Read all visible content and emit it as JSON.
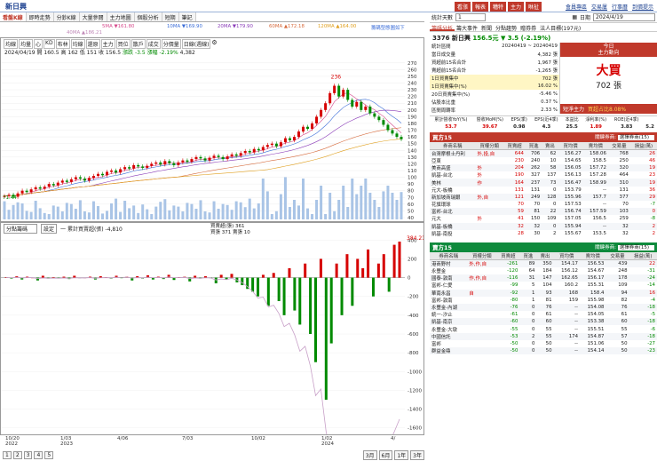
{
  "window": {
    "title": "新日興"
  },
  "top_buttons": [
    "看漲",
    "報表",
    "糟特",
    "主力",
    "咻扯"
  ],
  "top_links": [
    "會員專區",
    "交易屢",
    "行事曆",
    "到價提示"
  ],
  "tabs": [
    {
      "label": "看盤K線",
      "active": true
    },
    {
      "label": "即時走勢"
    },
    {
      "label": "分鈔K線"
    },
    {
      "label": "大量參閱"
    },
    {
      "label": "主力地圖"
    },
    {
      "label": "個股分析"
    },
    {
      "label": "短期"
    },
    {
      "label": "筆記"
    }
  ],
  "ma_legend": [
    {
      "label": "5MA ▼161.80",
      "color": "#d64b8c"
    },
    {
      "label": "10MA ▼169.90",
      "color": "#3c6ed8"
    },
    {
      "label": "20MA ▼179.90",
      "color": "#8a3cb8"
    },
    {
      "label": "60MA ▲172.18",
      "color": "#d66a3c"
    },
    {
      "label": "120MA ▲164.00",
      "color": "#e0a020"
    },
    {
      "label": "40MA ▲186.21",
      "color": "#c08ab8"
    }
  ],
  "ma_note": "籌碼型態圖如下",
  "chart_toolbar": [
    "均線",
    "均量",
    "心",
    "KD",
    "布林",
    "均線",
    "還原",
    "主力",
    "買位",
    "散戶",
    "成交",
    "分價量",
    "日線(週線)"
  ],
  "chart_info": {
    "date_line": "2024/04/19 開 160.5 高 162 低 151 收 156.5",
    "change": "漲跌 -3.5 漲幅 -2.19%",
    "volume": "4,382"
  },
  "price_axis": [
    "270",
    "260",
    "250",
    "240",
    "230",
    "220",
    "210",
    "200",
    "190",
    "180",
    "170",
    "160",
    "150",
    "140",
    "130",
    "120",
    "110",
    "100",
    "90",
    "80",
    "70",
    "60",
    "50",
    "40"
  ],
  "peak_label": "236",
  "low_label": "71.44",
  "sub_chart": {
    "selector": "分點籌碼",
    "btn": "設定",
    "legend_line1": "一 累計買賣超(張) -4,810",
    "legend_line2": "買賣超(張) 361",
    "legend_line3": "買張 371 賣張 10",
    "right_value": "384.21",
    "right_value2": "361",
    "axis": [
      "400",
      "200",
      "0",
      "-200",
      "-400",
      "-600",
      "-800",
      "-1000",
      "-1200",
      "-1400",
      "-1600"
    ]
  },
  "x_axis": [
    {
      "label": "10/20",
      "sub": "2022"
    },
    {
      "label": "1/03",
      "sub": "2023"
    },
    {
      "label": "4/06",
      "sub": ""
    },
    {
      "label": "7/03",
      "sub": ""
    },
    {
      "label": "10/02",
      "sub": ""
    },
    {
      "label": "1/02",
      "sub": "2024"
    },
    {
      "label": "4/",
      "sub": ""
    }
  ],
  "pager": [
    "1",
    "2",
    "3",
    "4",
    "5"
  ],
  "range_btns": [
    "3月",
    "6月",
    "1年",
    "3年"
  ],
  "right_panel": {
    "select_label": "統計天數",
    "days": "1",
    "date_label": "日期",
    "date": "2024/4/19",
    "subtabs": [
      "籌碼分析",
      "籌大事件",
      "新聞",
      "分點趨勢",
      "贈券券",
      "法人目標(197元)"
    ],
    "stock": "3376 新日興",
    "price": "156.5元",
    "change": "▼ 3.5 (-2.19%)",
    "stats": [
      {
        "k": "統計區間",
        "v": "20240419 ~ 20240419"
      },
      {
        "k": "當日成交量",
        "v": "4,382 張"
      },
      {
        "k": "買超前15名合計",
        "v": "1,967 張"
      },
      {
        "k": "賣超前15名合計",
        "v": "-1,265 張"
      },
      {
        "k": "1日買賣集中",
        "v": "702 張"
      },
      {
        "k": "1日買賣集中(%)",
        "v": "16.02 %"
      },
      {
        "k": "20日買賣集中(%)",
        "v": "-5.46 %"
      },
      {
        "k": "佔股本比重",
        "v": "0.37 %"
      },
      {
        "k": "區間周轉率",
        "v": "2.33 %"
      }
    ],
    "today_box": {
      "line1": "今日",
      "line2": "主力動向",
      "big": "大買",
      "amount": "702 張"
    },
    "short_term": {
      "label": "短淨主力",
      "text": "買超占比8.08%"
    },
    "metrics_head": [
      "累計營收YoY(%)",
      "營收MoM(%)",
      "EPS(季)",
      "EPS(近4季)",
      "本益比",
      "淨利率(%)",
      "ROE(近4季)"
    ],
    "metrics_val": [
      "53.7",
      "39.67",
      "0.98",
      "4.3",
      "25.5",
      "1.89",
      "3.83",
      "5.2"
    ],
    "buy_section": {
      "title": "買方15",
      "label": "關鍵券商:",
      "sel": "選擇券商(15)"
    },
    "sell_section": {
      "title": "賣方15",
      "label": "關鍵券商:",
      "sel": "選擇券商(15)"
    },
    "cols": [
      "券商名稱",
      "買權分類",
      "買賣超",
      "買進",
      "賣出",
      "買均價",
      "賣均價",
      "交易量",
      "損益(萬)"
    ],
    "buy_rows": [
      [
        "台灣摩根士丹利",
        "外,投,自",
        "644",
        "706",
        "62",
        "156.27",
        "158.06",
        "768",
        "26"
      ],
      [
        "亞東",
        "",
        "230",
        "240",
        "10",
        "154.65",
        "158.5",
        "250",
        "46"
      ],
      [
        "美商高盛",
        "外",
        "204",
        "262",
        "58",
        "156.05",
        "157.72",
        "320",
        "19"
      ],
      [
        "凱基-台北",
        "外",
        "190",
        "327",
        "137",
        "156.13",
        "157.28",
        "464",
        "23"
      ],
      [
        "美林",
        "作",
        "164",
        "237",
        "73",
        "156.47",
        "158.99",
        "310",
        "19"
      ],
      [
        "元大-板橋",
        "",
        "131",
        "131",
        "0",
        "153.79",
        "--",
        "131",
        "36"
      ],
      [
        "新加坡商瑞銀",
        "外,自",
        "121",
        "249",
        "128",
        "155.96",
        "157.7",
        "377",
        "29"
      ],
      [
        "花旗環球",
        "",
        "70",
        "70",
        "0",
        "157.53",
        "--",
        "70",
        "-7"
      ],
      [
        "富邦-台北",
        "",
        "59",
        "81",
        "22",
        "156.74",
        "157.59",
        "103",
        "0"
      ],
      [
        "元大",
        "外",
        "41",
        "150",
        "109",
        "157.05",
        "156.5",
        "259",
        "-8"
      ],
      [
        "凱基-板橋",
        "",
        "32",
        "32",
        "0",
        "155.94",
        "--",
        "32",
        "2"
      ],
      [
        "凱基-南投",
        "",
        "28",
        "30",
        "2",
        "155.67",
        "153.5",
        "32",
        "2"
      ]
    ],
    "sell_rows": [
      [
        "港商野村",
        "外,作,自",
        "-261",
        "89",
        "350",
        "154.17",
        "156.53",
        "439",
        "22"
      ],
      [
        "永豐金",
        "",
        "-120",
        "64",
        "184",
        "156.12",
        "154.67",
        "248",
        "-31"
      ],
      [
        "國泰-敦南",
        "作,作,自",
        "-116",
        "31",
        "147",
        "162.65",
        "156.17",
        "178",
        "-24"
      ],
      [
        "富邦-仁愛",
        "",
        "-99",
        "5",
        "104",
        "160.2",
        "155.31",
        "109",
        "-14"
      ],
      [
        "華南永昌",
        "自",
        "-92",
        "1",
        "93",
        "168",
        "158.4",
        "94",
        "16"
      ],
      [
        "富邦-敦南",
        "",
        "-80",
        "1",
        "81",
        "159",
        "155.98",
        "82",
        "-4"
      ],
      [
        "永豐金-內湖",
        "",
        "-76",
        "0",
        "76",
        "--",
        "154.08",
        "76",
        "-18"
      ],
      [
        "統一-汐止",
        "",
        "-61",
        "0",
        "61",
        "--",
        "154.05",
        "61",
        "-5"
      ],
      [
        "凱基-南京",
        "",
        "-60",
        "0",
        "60",
        "--",
        "153.38",
        "60",
        "-18"
      ],
      [
        "永豐金-大墩",
        "",
        "-55",
        "0",
        "55",
        "--",
        "155.51",
        "55",
        "-6"
      ],
      [
        "中國信託",
        "",
        "-53",
        "2",
        "55",
        "174",
        "154.87",
        "57",
        "-18"
      ],
      [
        "富邦",
        "",
        "-50",
        "0",
        "50",
        "--",
        "151.06",
        "50",
        "-27"
      ],
      [
        "群益金鼎",
        "",
        "-50",
        "0",
        "50",
        "--",
        "154.14",
        "50",
        "-23"
      ]
    ],
    "tags": [
      "短淨主力",
      "短淨主力",
      "短淨主力"
    ]
  },
  "chart_data": {
    "type": "line",
    "price_range": [
      40,
      275
    ],
    "price_series": [
      72,
      74,
      71,
      76,
      80,
      78,
      82,
      85,
      83,
      86,
      90,
      88,
      92,
      95,
      93,
      97,
      100,
      98,
      95,
      99,
      102,
      105,
      103,
      108,
      110,
      107,
      112,
      115,
      113,
      118,
      116,
      114,
      117,
      120,
      122,
      119,
      124,
      121,
      118,
      122,
      125,
      123,
      127,
      130,
      128,
      125,
      129,
      132,
      130,
      127,
      131,
      134,
      132,
      136,
      139,
      137,
      142,
      140,
      145,
      148,
      150,
      146,
      152,
      158,
      155,
      160,
      168,
      175,
      172,
      180,
      190,
      200,
      210,
      225,
      236,
      220,
      230,
      215,
      205,
      212,
      200,
      205,
      195,
      190,
      185,
      178,
      170,
      165,
      160,
      156.5
    ],
    "flow_series": [
      5,
      -10,
      15,
      -20,
      10,
      0,
      -30,
      20,
      -10,
      5,
      -5,
      10,
      -15,
      20,
      -5,
      0,
      10,
      -20,
      15,
      5,
      -10,
      20,
      -5,
      10,
      -30,
      15,
      -10,
      25,
      -20,
      10,
      -15,
      30,
      -25,
      5,
      10,
      -40,
      20,
      -10,
      15,
      -5,
      -60,
      30,
      -20,
      40,
      -50,
      -80,
      -120,
      -150,
      -200,
      30,
      -300,
      50,
      -250,
      -400,
      100,
      -350,
      -500,
      150,
      -600,
      -900,
      200,
      -1300,
      -700,
      150,
      -400,
      250,
      -300,
      200,
      100,
      300,
      -200,
      150,
      250,
      -150,
      350,
      384
    ],
    "cum_series": [
      -4810
    ]
  }
}
